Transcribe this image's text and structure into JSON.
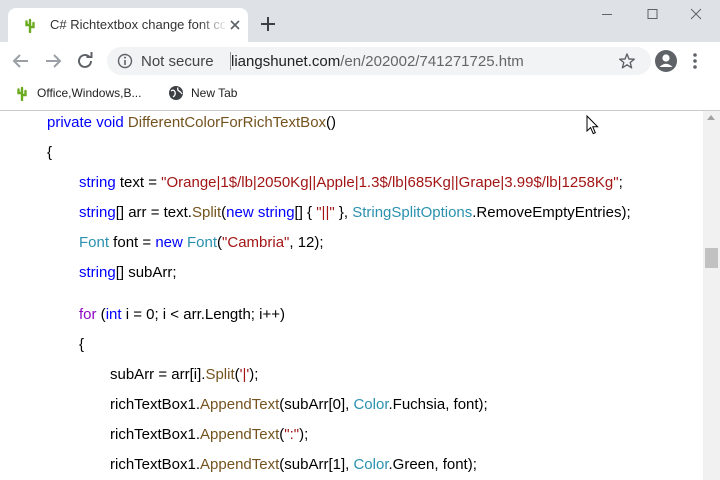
{
  "browser": {
    "tab": {
      "title": "C# Richtextbox change font color",
      "favicon": "cactus-favicon",
      "close_icon": "close-icon"
    },
    "new_tab_icon": "plus-icon",
    "window_controls": [
      "minimize-icon",
      "maximize-icon",
      "close-icon"
    ],
    "nav": [
      "back-icon",
      "forward-icon",
      "reload-icon"
    ],
    "omnibox": {
      "security_label": "Not secure",
      "host": "liangshunet.com",
      "path": "/en/202002/741271725.htm"
    },
    "bookmarks": [
      {
        "label": "Office,Windows,B...",
        "icon": "cactus-icon"
      },
      {
        "label": "New Tab",
        "icon": "globe-icon"
      }
    ]
  },
  "colors": {
    "keyword": "#0000ff",
    "type": "#2b91af",
    "method": "#74531f",
    "string": "#a31515",
    "control": "#8f08c4"
  },
  "code": {
    "line1": {
      "kw1": "private",
      "kw2": "void",
      "name": "DifferentColorForRichTextBox",
      "paren": "()"
    },
    "line2": {
      "brace": "{"
    },
    "line3": {
      "kw": "string",
      "rest": " text = ",
      "str": "\"Orange|1$/lb|2050Kg||Apple|1.3$/lb|685Kg||Grape|3.99$/lb|1258Kg\"",
      "end": ";"
    },
    "line4": {
      "kw": "string",
      "a": "[] arr = text.",
      "m": "Split",
      "b": "(",
      "kw2": "new",
      "c": " ",
      "kw3": "string",
      "d": "[] { ",
      "str": "\"||\"",
      "e": " }, ",
      "ty": "StringSplitOptions",
      "f": ".RemoveEmptyEntries);"
    },
    "line5": {
      "ty": "Font",
      "a": " font = ",
      "kw": "new",
      "b": " ",
      "ty2": "Font",
      "c": "(",
      "str": "\"Cambria\"",
      "d": ", 12);"
    },
    "line6": {
      "kw": "string",
      "rest": "[] subArr;"
    },
    "line7": {
      "ct": "for",
      "a": " (",
      "kw": "int",
      "b": " i = 0; i < arr.Length; i++)"
    },
    "line8": {
      "brace": "{"
    },
    "line9": {
      "a": "subArr = arr[i].",
      "m": "Split",
      "b": "(",
      "str": "'|'",
      "c": ");"
    },
    "line10": {
      "a": "richTextBox1.",
      "m": "AppendText",
      "b": "(subArr[0], ",
      "ty": "Color",
      "c": ".Fuchsia, font);"
    },
    "line11": {
      "a": "richTextBox1.",
      "m": "AppendText",
      "b": "(",
      "str": "\":\"",
      "c": ");"
    },
    "line12": {
      "a": "richTextBox1.",
      "m": "AppendText",
      "b": "(subArr[1], ",
      "ty": "Color",
      "c": ".Green, font);"
    }
  }
}
